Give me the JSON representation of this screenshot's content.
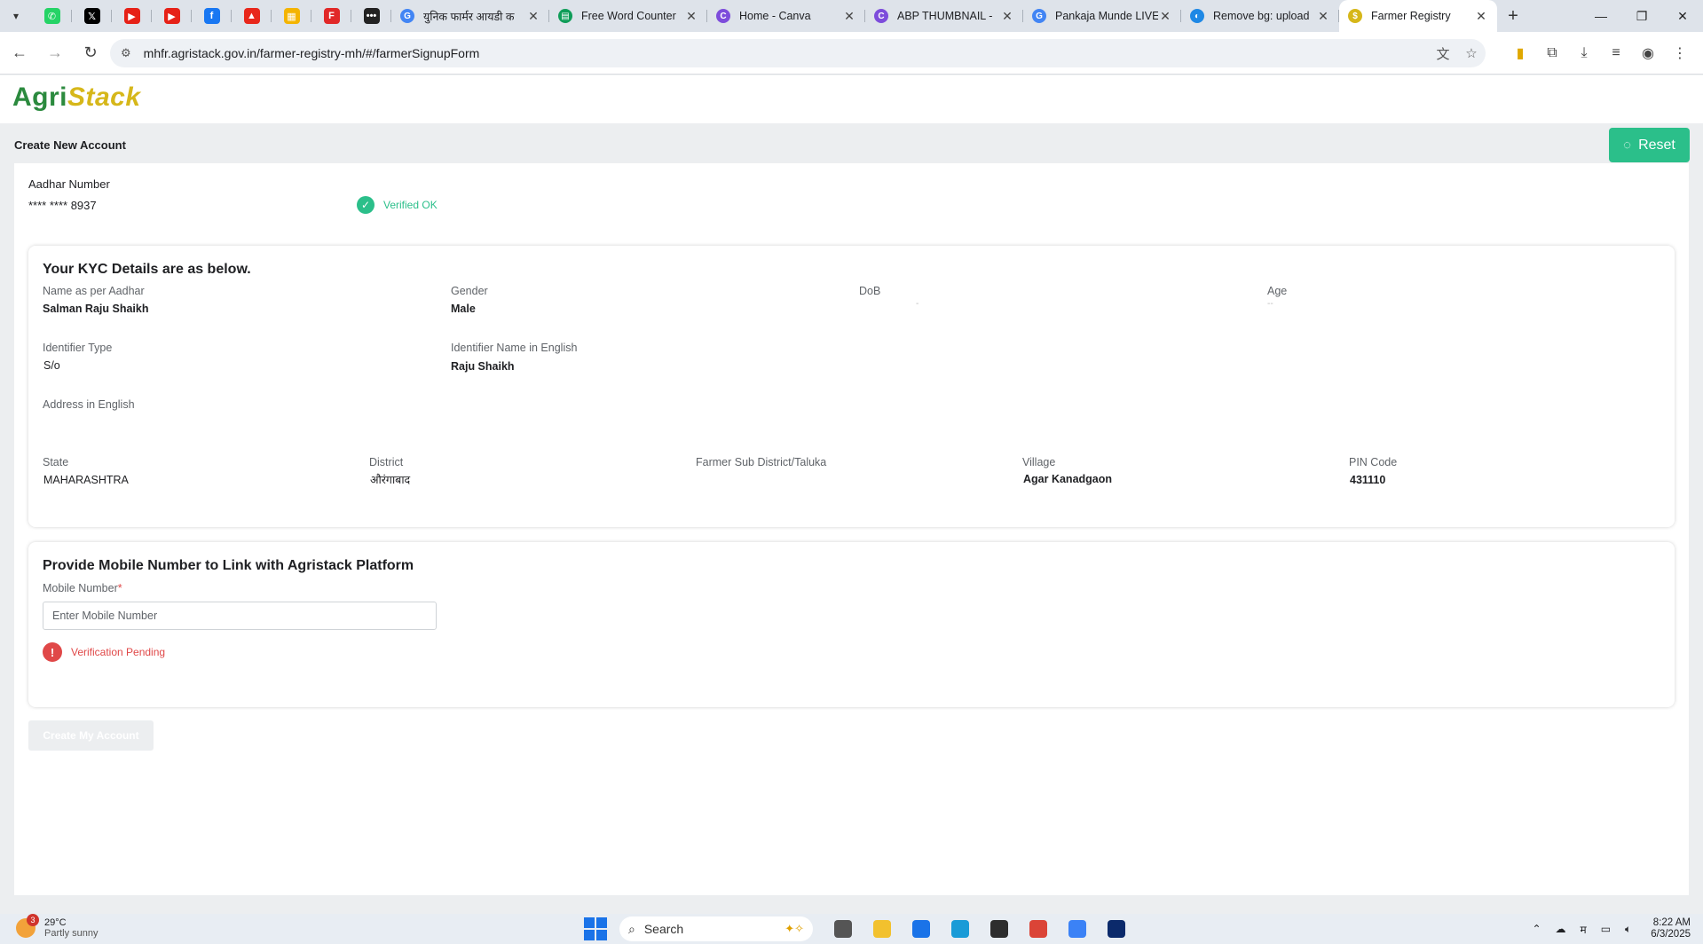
{
  "browser": {
    "pinned_tabs": [
      {
        "name": "whatsapp-icon",
        "color": "#25d366",
        "glyph": "✆"
      },
      {
        "name": "x-icon",
        "color": "#000000",
        "glyph": "𝕏"
      },
      {
        "name": "youtube-icon",
        "color": "#e62117",
        "glyph": "▶"
      },
      {
        "name": "youtube-icon",
        "color": "#e62117",
        "glyph": "▶"
      },
      {
        "name": "facebook-icon",
        "color": "#1877f2",
        "glyph": "f"
      },
      {
        "name": "adobe-icon",
        "color": "#e8271b",
        "glyph": "▲"
      },
      {
        "name": "apps-icon",
        "color": "#f4b400",
        "glyph": "▦"
      },
      {
        "name": "flipboard-icon",
        "color": "#e12828",
        "glyph": "F"
      },
      {
        "name": "dots-icon",
        "color": "#222222",
        "glyph": "•••"
      }
    ],
    "tabs": [
      {
        "title": "युनिक फार्मर आयडी क",
        "fav_color": "#4285f4",
        "fav_glyph": "G"
      },
      {
        "title": "Free Word Counter",
        "fav_color": "#0f9d58",
        "fav_glyph": "▤"
      },
      {
        "title": "Home - Canva",
        "fav_color": "#7d4cdb",
        "fav_glyph": "C"
      },
      {
        "title": "ABP THUMBNAIL -",
        "fav_color": "#7d4cdb",
        "fav_glyph": "C"
      },
      {
        "title": "Pankaja Munde LIVE",
        "fav_color": "#4285f4",
        "fav_glyph": "G"
      },
      {
        "title": "Remove bg: upload",
        "fav_color": "#1e88e5",
        "fav_glyph": "◐"
      },
      {
        "title": "Farmer Registry",
        "fav_color": "#d6b71a",
        "fav_glyph": "$",
        "active": true
      }
    ],
    "url": "mhfr.agristack.gov.in/farmer-registry-mh/#/farmerSignupForm"
  },
  "header": {
    "logo_agri": "Agri",
    "logo_stack": "Stack",
    "page_title": "Create New Account",
    "reset_label": "Reset"
  },
  "aadhar": {
    "label": "Aadhar Number",
    "value": "**** **** 8937",
    "status": "Verified OK",
    "status_color": "#2bbf8a"
  },
  "kyc": {
    "title": "Your KYC Details are as below.",
    "name_label": "Name as per Aadhar",
    "name_value": "Salman Raju Shaikh",
    "gender_label": "Gender",
    "gender_value": "Male",
    "dob_label": "DoB",
    "dob_value": "-",
    "age_label": "Age",
    "age_value": "--",
    "identifier_type_label": "Identifier Type",
    "identifier_type_value": "S/o",
    "identifier_name_label": "Identifier Name in English",
    "identifier_name_value": "Raju Shaikh",
    "address_label": "Address in English",
    "state_label": "State",
    "state_value": "MAHARASHTRA",
    "district_label": "District",
    "district_value": "औरंगाबाद",
    "subdistrict_label": "Farmer Sub District/Taluka",
    "village_label": "Village",
    "village_value": "Agar Kanadgaon",
    "pin_label": "PIN Code",
    "pin_value": "431110"
  },
  "mobile": {
    "title": "Provide Mobile Number to Link with Agristack Platform",
    "label": "Mobile Number",
    "required_mark": "*",
    "placeholder": "Enter Mobile Number",
    "status": "Verification Pending",
    "status_color": "#e04848"
  },
  "actions": {
    "create_label": "Create My Account"
  },
  "taskbar": {
    "weather_badge": "3",
    "temperature": "29°C",
    "condition": "Partly sunny",
    "search_placeholder": "Search",
    "apps": [
      {
        "name": "task-view-icon",
        "color": "#555555"
      },
      {
        "name": "file-explorer-icon",
        "color": "#f2c12e"
      },
      {
        "name": "store-icon",
        "color": "#1a73e8"
      },
      {
        "name": "edge-icon",
        "color": "#1a9bd7"
      },
      {
        "name": "sticky-notes-icon",
        "color": "#2d2d2d"
      },
      {
        "name": "chrome-icon",
        "color": "#db4437"
      },
      {
        "name": "notepad-icon",
        "color": "#3b82f6"
      },
      {
        "name": "omega-app-icon",
        "color": "#0b2a6b"
      }
    ],
    "lang": "म",
    "time": "8:22 AM",
    "date": "6/3/2025"
  }
}
